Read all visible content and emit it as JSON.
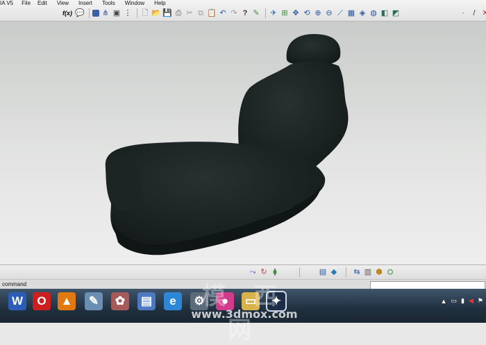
{
  "app": {
    "title_fragment": "IA V5"
  },
  "menu": {
    "items": [
      "IA V5",
      "File",
      "Edit",
      "View",
      "Insert",
      "Tools",
      "Window",
      "Help"
    ]
  },
  "toolbar": {
    "fx_label": "f(x)",
    "icons": [
      "formula-icon",
      "comment-icon",
      "grid-icon",
      "tree-icon",
      "catalog-icon",
      "new-icon",
      "open-icon",
      "save-icon",
      "print-icon",
      "cut-icon",
      "copy-icon",
      "paste-icon",
      "undo-icon",
      "redo-icon",
      "help-icon",
      "whats-this-icon",
      "fly-icon",
      "fit-all-icon",
      "pan-icon",
      "rotate-icon",
      "zoom-in-icon",
      "zoom-out-icon",
      "normal-view-icon",
      "multi-view-icon",
      "iso-view-icon",
      "render-style-icon",
      "hide-show-icon",
      "swap-icon"
    ]
  },
  "viewport": {
    "object": "car-seat-model"
  },
  "bottom_toolbar": {
    "icons": [
      "sketch-icon",
      "pad-icon",
      "pocket-icon",
      "measure-icon",
      "apply-material-icon",
      "split-icon",
      "layer-icon",
      "part-icon",
      "assembly-icon"
    ]
  },
  "command": {
    "label": "command",
    "value": ""
  },
  "taskbar": {
    "apps": [
      {
        "name": "word-app",
        "glyph": "W",
        "color": "#2b5cb8"
      },
      {
        "name": "opera-app",
        "glyph": "O",
        "color": "#cc1f1f"
      },
      {
        "name": "vlc-app",
        "glyph": "▲",
        "color": "#e07a10"
      },
      {
        "name": "paint-app",
        "glyph": "✎",
        "color": "#6b8fb3"
      },
      {
        "name": "tool-app",
        "glyph": "✿",
        "color": "#a65a5a"
      },
      {
        "name": "pdf-app",
        "glyph": "▤",
        "color": "#4d78c2"
      },
      {
        "name": "ie-app",
        "glyph": "e",
        "color": "#2d87d6"
      },
      {
        "name": "network-app",
        "glyph": "⚙",
        "color": "#5b6b7a"
      },
      {
        "name": "media-app",
        "glyph": "●",
        "color": "#d23a8c"
      },
      {
        "name": "folder-app",
        "glyph": "▭",
        "color": "#d8b24a"
      },
      {
        "name": "catia-app",
        "glyph": "✦",
        "color": "#375a8c"
      }
    ]
  },
  "watermark": {
    "chinese": "模 西 网",
    "url": "www.3dmox.com"
  }
}
